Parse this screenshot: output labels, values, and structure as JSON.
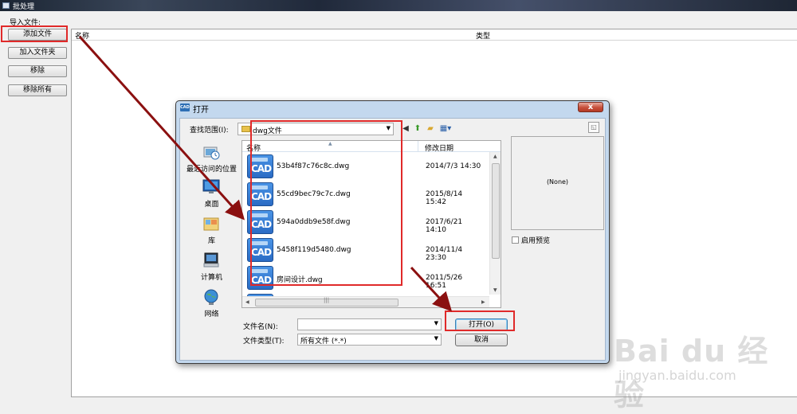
{
  "app": {
    "title": "批处理",
    "import_label": "导入文件:",
    "buttons": {
      "add_file": "添加文件",
      "add_folder": "加入文件夹",
      "remove": "移除",
      "remove_all": "移除所有"
    },
    "columns": {
      "name": "名称",
      "type": "类型"
    }
  },
  "dialog": {
    "title": "打开",
    "icon_text": "CAD",
    "close_glyph": "x",
    "look_in_label": "查找范围(I):",
    "look_in_value": "dwg文件",
    "places": [
      {
        "label": "最近访问的位置",
        "icon": "recent-places-icon"
      },
      {
        "label": "桌面",
        "icon": "desktop-icon"
      },
      {
        "label": "库",
        "icon": "libraries-icon"
      },
      {
        "label": "计算机",
        "icon": "computer-icon"
      },
      {
        "label": "网络",
        "icon": "network-icon"
      }
    ],
    "list_header": {
      "name": "名称",
      "modified": "修改日期"
    },
    "files": [
      {
        "name": "53b4f87c76c8c.dwg",
        "date": "2014/7/3 14:30"
      },
      {
        "name": "55cd9bec79c7c.dwg",
        "date": "2015/8/14 15:42"
      },
      {
        "name": "594a0ddb9e58f.dwg",
        "date": "2017/6/21 14:10"
      },
      {
        "name": "5458f119d5480.dwg",
        "date": "2014/11/4 23:30"
      },
      {
        "name": "房间设计.dwg",
        "date": "2011/5/26 16:51"
      }
    ],
    "file_icon_text": "CAD",
    "preview_text": "(None)",
    "preview_checkbox": "启用预览",
    "filename_label": "文件名(N):",
    "filename_value": "",
    "filetype_label": "文件类型(T):",
    "filetype_value": "所有文件 (*.*)",
    "open_button": "打开(O)",
    "cancel_button": "取消"
  },
  "watermark": {
    "brand": "Bai du 经验",
    "url": "jingyan.baidu.com"
  },
  "highlight_color": "#e02a2a",
  "arrow_color": "#8b1010"
}
